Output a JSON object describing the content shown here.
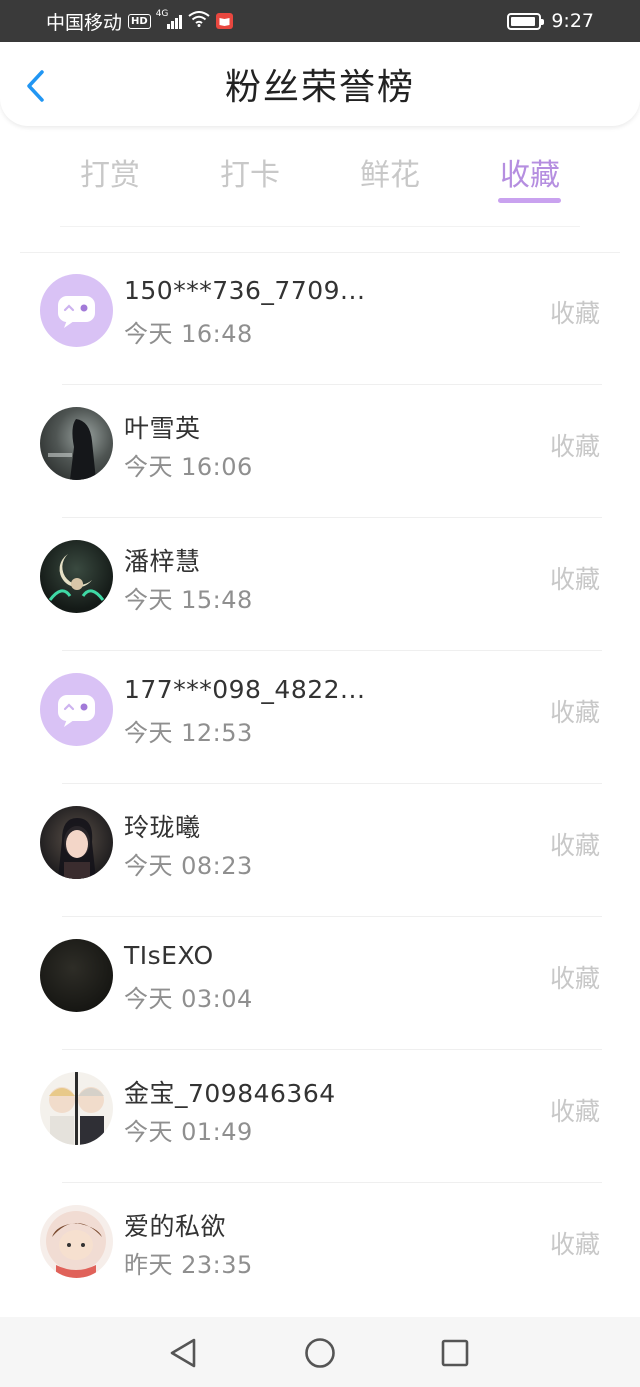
{
  "status_bar": {
    "carrier": "中国移动",
    "hd": "HD",
    "network": "4G",
    "time": "9:27",
    "battery_level": 0.9
  },
  "header": {
    "title": "粉丝荣誉榜"
  },
  "tabs": [
    {
      "label": "打赏",
      "active": false
    },
    {
      "label": "打卡",
      "active": false
    },
    {
      "label": "鲜花",
      "active": false
    },
    {
      "label": "收藏",
      "active": true
    }
  ],
  "colors": {
    "accent": "#b58ee0",
    "underline": "#c9a2ef",
    "status_bar": "#3a3a3a",
    "inactive_text": "#c8c8c8",
    "default_avatar": "#d9c2f5"
  },
  "items": [
    {
      "name": "150***736_7709...",
      "time": "今天 16:48",
      "action": "收藏",
      "avatar": "default-chat-avatar"
    },
    {
      "name": "叶雪英",
      "time": "今天 16:06",
      "action": "收藏",
      "avatar": "photo-avatar"
    },
    {
      "name": "潘梓慧",
      "time": "今天 15:48",
      "action": "收藏",
      "avatar": "photo-avatar"
    },
    {
      "name": "177***098_4822...",
      "time": "今天 12:53",
      "action": "收藏",
      "avatar": "default-chat-avatar"
    },
    {
      "name": "玲珑曦",
      "time": "今天 08:23",
      "action": "收藏",
      "avatar": "photo-avatar"
    },
    {
      "name": "TIsEXO",
      "time": "今天 03:04",
      "action": "收藏",
      "avatar": "photo-avatar"
    },
    {
      "name": "金宝_709846364",
      "time": "今天 01:49",
      "action": "收藏",
      "avatar": "photo-avatar"
    },
    {
      "name": "爱的私欲",
      "time": "昨天 23:35",
      "action": "收藏",
      "avatar": "photo-avatar"
    }
  ],
  "nav": {
    "back": "back-triangle-icon",
    "home": "home-circle-icon",
    "recents": "recents-square-icon"
  }
}
